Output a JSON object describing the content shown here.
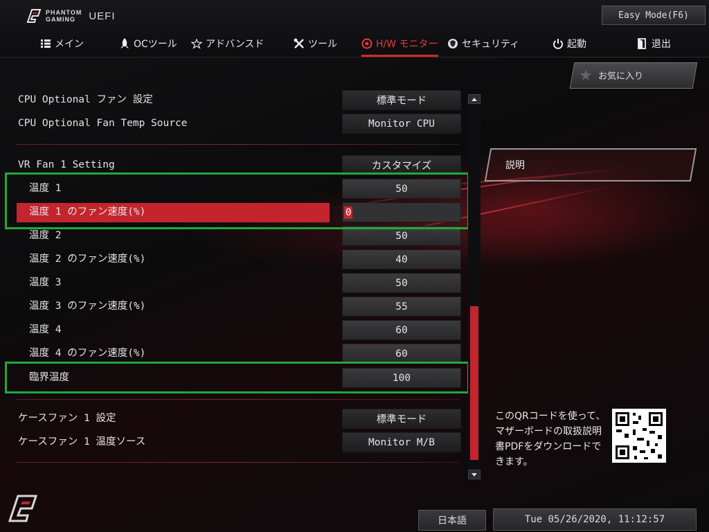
{
  "header": {
    "logo_line1": "PHANTOM",
    "logo_line2": "GAMING",
    "logo_uefi": "UEFI",
    "easy_mode_label": "Easy Mode(F6)"
  },
  "tabs": [
    {
      "label": "メイン",
      "icon": "list-icon"
    },
    {
      "label": "OCツール",
      "icon": "rocket-icon"
    },
    {
      "label": "アドバンスド",
      "icon": "star-icon"
    },
    {
      "label": "ツール",
      "icon": "tools-icon"
    },
    {
      "label": "H/W モニター",
      "icon": "monitor-icon",
      "active": true
    },
    {
      "label": "セキュリティ",
      "icon": "shield-icon"
    },
    {
      "label": "起動",
      "icon": "power-icon"
    },
    {
      "label": "退出",
      "icon": "exit-icon"
    }
  ],
  "settings": {
    "cpu_opt_fan": {
      "label": "CPU Optional ファン 設定",
      "value": "標準モード"
    },
    "cpu_opt_temp_src": {
      "label": "CPU Optional Fan Temp Source",
      "value": "Monitor CPU"
    },
    "vr_fan": {
      "label": "VR Fan 1 Setting",
      "value": "カスタマイズ"
    },
    "temp1": {
      "label": "温度 1",
      "value": "50"
    },
    "temp1_speed": {
      "label": "温度 1 のファン速度(%)",
      "value": "0"
    },
    "temp2": {
      "label": "温度 2",
      "value": "50"
    },
    "temp2_speed": {
      "label": "温度 2 のファン速度(%)",
      "value": "40"
    },
    "temp3": {
      "label": "温度 3",
      "value": "50"
    },
    "temp3_speed": {
      "label": "温度 3 のファン速度(%)",
      "value": "55"
    },
    "temp4": {
      "label": "温度 4",
      "value": "60"
    },
    "temp4_speed": {
      "label": "温度 4 のファン速度(%)",
      "value": "60"
    },
    "critical": {
      "label": "臨界温度",
      "value": "100"
    },
    "case_fan": {
      "label": "ケースファン 1 設定",
      "value": "標準モード"
    },
    "case_fan_src": {
      "label": "ケースファン 1 温度ソース",
      "value": "Monitor M/B"
    }
  },
  "right": {
    "favorites_label": "お気に入り",
    "description_label": "説明",
    "qr_text": "このQRコードを使って、マザーボードの取扱説明書PDFをダウンロードできます。"
  },
  "footer": {
    "language": "日本語",
    "datetime": "Tue 05/26/2020, 11:12:57"
  },
  "colors": {
    "accent": "#c4242e",
    "annotation_box": "#1faa3a"
  }
}
